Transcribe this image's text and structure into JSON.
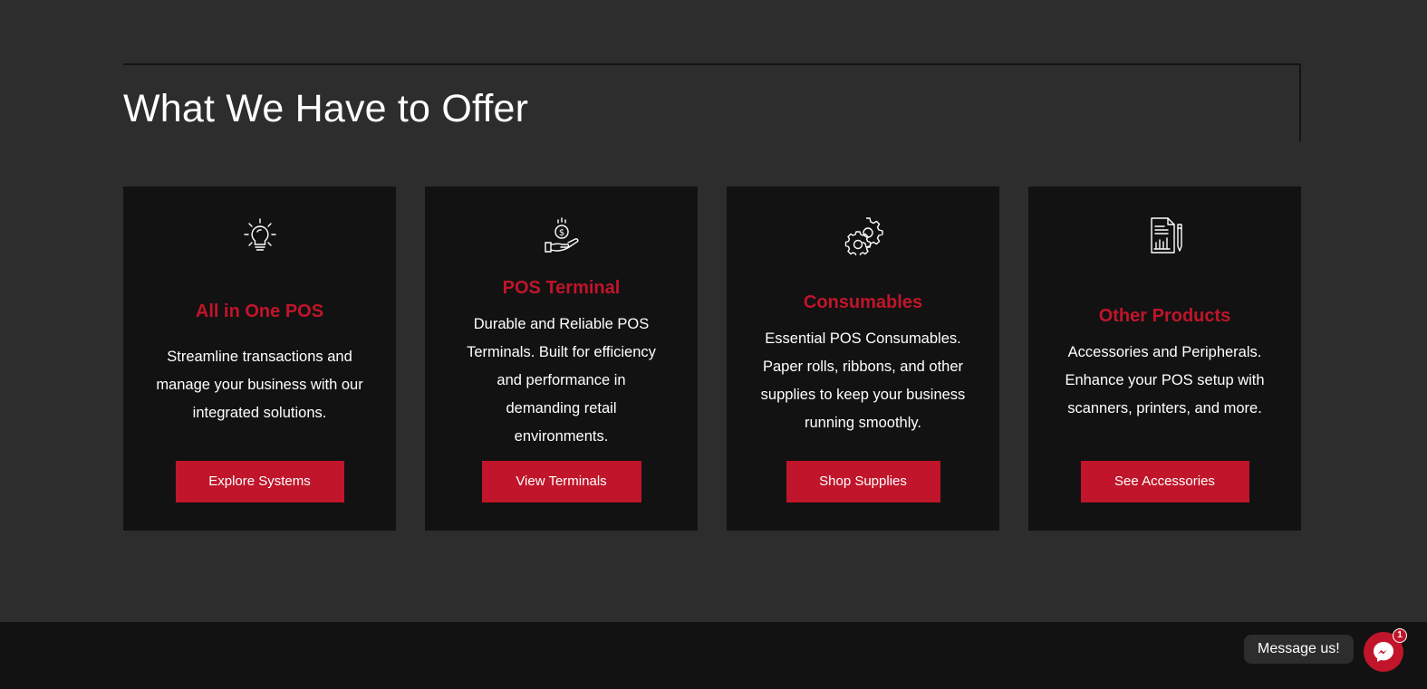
{
  "section": {
    "heading": "What We Have to Offer"
  },
  "cards": [
    {
      "icon": "lightbulb-icon",
      "title": "All in One POS",
      "description_lines": [
        "Streamline transactions and",
        "manage your business with our",
        "integrated solutions."
      ],
      "button": "Explore Systems"
    },
    {
      "icon": "money-hand-icon",
      "title": "POS Terminal",
      "description_lines": [
        "Durable and Reliable POS",
        "Terminals. Built for efficiency",
        "and performance in",
        "demanding retail",
        "environments."
      ],
      "button": "View Terminals"
    },
    {
      "icon": "gears-icon",
      "title": "Consumables",
      "description_lines": [
        "Essential POS Consumables.",
        "Paper rolls, ribbons, and other",
        "supplies to keep your business",
        "running smoothly."
      ],
      "button": "Shop Supplies"
    },
    {
      "icon": "report-document-icon",
      "title": "Other Products",
      "description_lines": [
        "Accessories and Peripherals.",
        "Enhance your POS setup with",
        "scanners, printers, and more."
      ],
      "button": "See Accessories"
    }
  ],
  "messenger": {
    "label": "Message us!",
    "badge_count": "1",
    "icon": "messenger-icon"
  },
  "colors": {
    "accent": "#c0152a",
    "background": "#2d2d2d",
    "card": "#121212",
    "footer": "#121212"
  }
}
